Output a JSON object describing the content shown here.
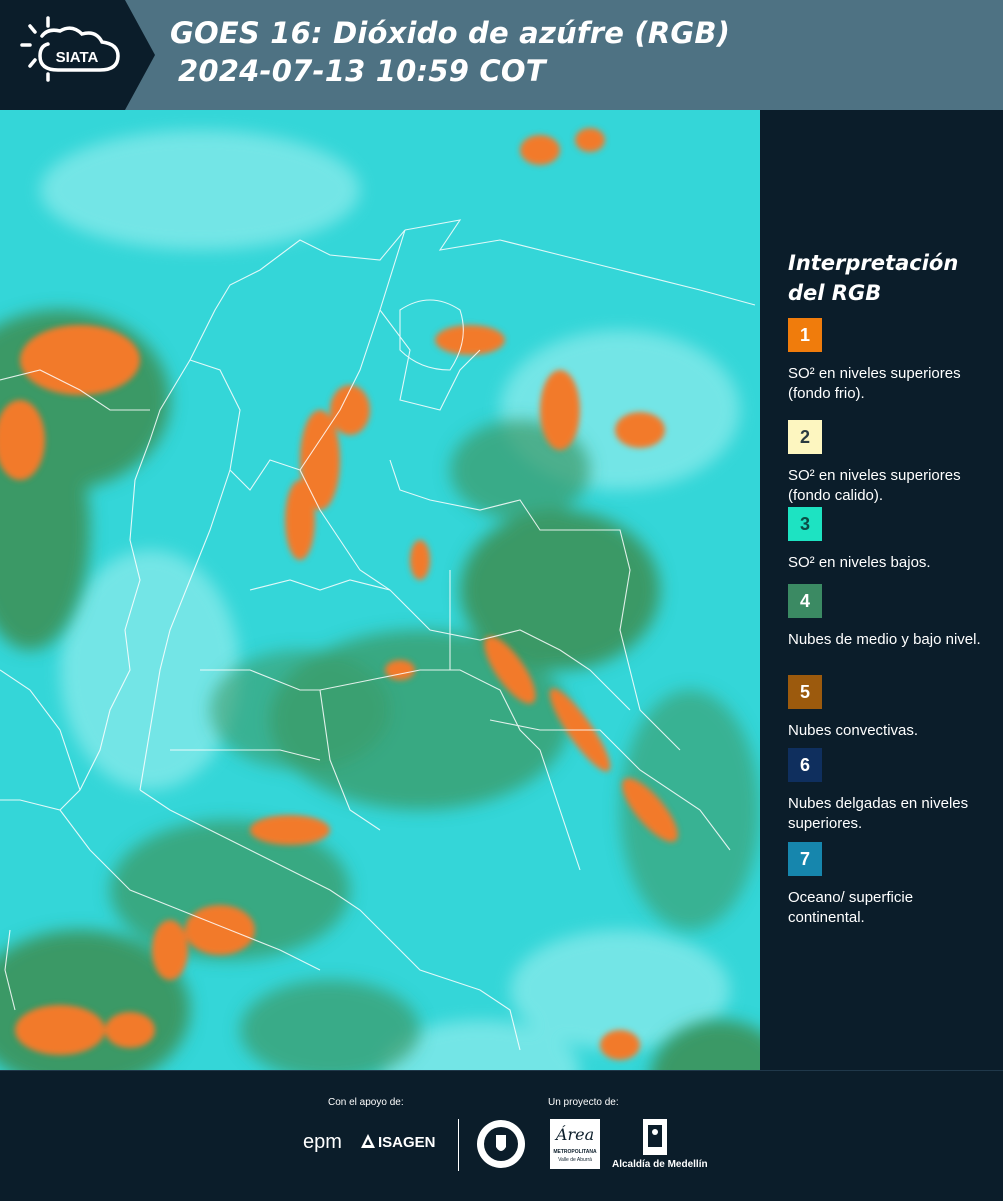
{
  "header": {
    "logo_text": "SIATA",
    "title_line1": "GOES 16: Dióxido de azúfre (RGB)",
    "title_line2": "2024-07-13 10:59 COT"
  },
  "legend": {
    "title_line1": "Interpretación",
    "title_line2": "del RGB",
    "items": [
      {
        "number": "1",
        "color": "#f07c0c",
        "label": "SO² en niveles superiores (fondo frio)."
      },
      {
        "number": "2",
        "color": "#fdf6c0",
        "label": "SO² en niveles superiores (fondo calido)."
      },
      {
        "number": "3",
        "color": "#1de3c2",
        "label": "SO² en niveles bajos."
      },
      {
        "number": "4",
        "color": "#3b8a63",
        "label": "Nubes de medio y bajo nivel."
      },
      {
        "number": "5",
        "color": "#9c5a0d",
        "label": "Nubes convectivas."
      },
      {
        "number": "6",
        "color": "#0f2f5e",
        "label": "Nubes delgadas en niveles superiores."
      },
      {
        "number": "7",
        "color": "#1686ad",
        "label": "Oceano/ superficie continental."
      }
    ]
  },
  "footer": {
    "support_label": "Con el apoyo de:",
    "project_label": "Un proyecto de:",
    "logo_epm": "epm",
    "logo_isagen": "ISAGEN",
    "logo_area": "Área",
    "logo_area_sub1": "METROPOLITANA",
    "logo_area_sub2": "Valle de Aburrá",
    "logo_alcaldia": "Alcaldía de Medellín"
  }
}
